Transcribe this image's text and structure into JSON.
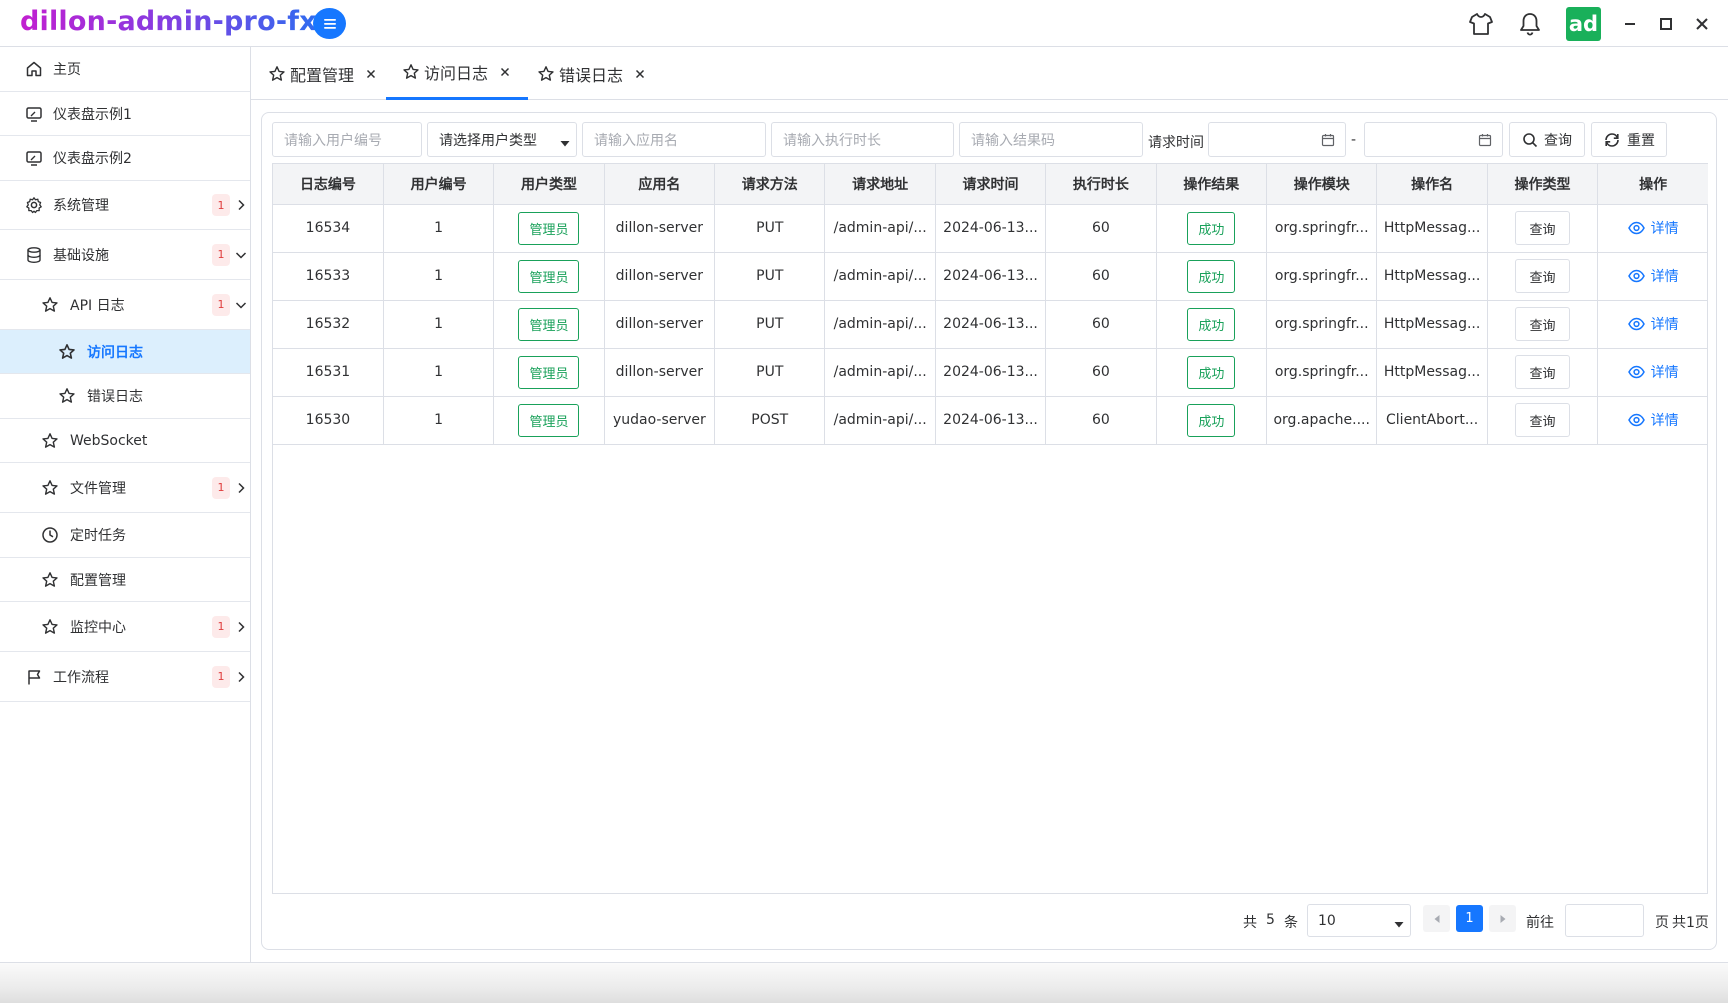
{
  "app": {
    "title": "dillon-admin-pro-fx",
    "avatar_text": "ad"
  },
  "sidebar": {
    "items": [
      {
        "label": "主页",
        "icon": "home-icon"
      },
      {
        "label": "仪表盘示例1",
        "icon": "monitor-icon"
      },
      {
        "label": "仪表盘示例2",
        "icon": "monitor-icon"
      },
      {
        "label": "系统管理",
        "icon": "gear-icon",
        "badge": "1"
      },
      {
        "label": "基础设施",
        "icon": "database-icon",
        "badge": "1"
      },
      {
        "label": "API 日志",
        "icon": "star-icon",
        "badge": "1"
      },
      {
        "label": "访问日志",
        "icon": "star-icon",
        "active": true
      },
      {
        "label": "错误日志",
        "icon": "star-icon"
      },
      {
        "label": "WebSocket",
        "icon": "star-icon"
      },
      {
        "label": "文件管理",
        "icon": "star-icon",
        "badge": "1"
      },
      {
        "label": "定时任务",
        "icon": "clock-icon"
      },
      {
        "label": "配置管理",
        "icon": "star-icon"
      },
      {
        "label": "监控中心",
        "icon": "star-icon",
        "badge": "1"
      },
      {
        "label": "工作流程",
        "icon": "flag-icon",
        "badge": "1"
      }
    ]
  },
  "tabs": [
    {
      "label": "配置管理"
    },
    {
      "label": "访问日志",
      "active": true
    },
    {
      "label": "错误日志"
    }
  ],
  "filters": {
    "user_id_placeholder": "请输入用户编号",
    "user_type_value": "请选择用户类型",
    "app_name_placeholder": "请输入应用名",
    "duration_placeholder": "请输入执行时长",
    "result_code_placeholder": "请输入结果码",
    "request_time_label": "请求时间",
    "range_separator": "-",
    "search_label": "查询",
    "reset_label": "重置"
  },
  "table": {
    "headers": [
      "日志编号",
      "用户编号",
      "用户类型",
      "应用名",
      "请求方法",
      "请求地址",
      "请求时间",
      "执行时长",
      "操作结果",
      "操作模块",
      "操作名",
      "操作类型",
      "操作"
    ],
    "rows": [
      [
        "16534",
        "1",
        "管理员",
        "dillon-server",
        "PUT",
        "/admin-api/...",
        "2024-06-13...",
        "60",
        "成功",
        "org.springfr...",
        "HttpMessag...",
        "查询",
        "详情"
      ],
      [
        "16533",
        "1",
        "管理员",
        "dillon-server",
        "PUT",
        "/admin-api/...",
        "2024-06-13...",
        "60",
        "成功",
        "org.springfr...",
        "HttpMessag...",
        "查询",
        "详情"
      ],
      [
        "16532",
        "1",
        "管理员",
        "dillon-server",
        "PUT",
        "/admin-api/...",
        "2024-06-13...",
        "60",
        "成功",
        "org.springfr...",
        "HttpMessag...",
        "查询",
        "详情"
      ],
      [
        "16531",
        "1",
        "管理员",
        "dillon-server",
        "PUT",
        "/admin-api/...",
        "2024-06-13...",
        "60",
        "成功",
        "org.springfr...",
        "HttpMessag...",
        "查询",
        "详情"
      ],
      [
        "16530",
        "1",
        "管理员",
        "yudao-server",
        "POST",
        "/admin-api/...",
        "2024-06-13...",
        "60",
        "成功",
        "org.apache....",
        "ClientAbort...",
        "查询",
        "详情"
      ]
    ]
  },
  "pagination": {
    "total_prefix": "共",
    "total": "5",
    "total_suffix": "条",
    "page_size": "10",
    "current_page": "1",
    "goto_label": "前往",
    "page_suffix": "页",
    "total_pages_text": "共1页"
  },
  "colors": {
    "accent": "#1677ff",
    "success": "#19a15a",
    "badge": "#e03c3c"
  }
}
